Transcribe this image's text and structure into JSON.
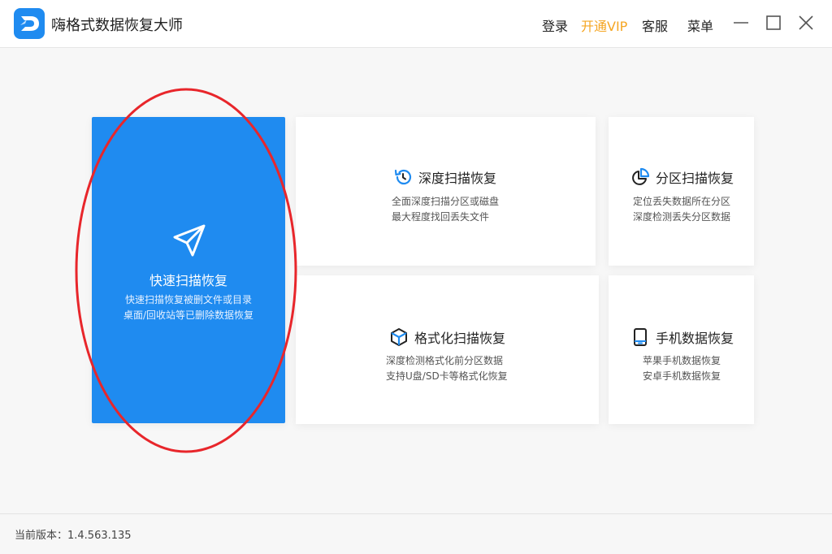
{
  "app": {
    "title": "嗨格式数据恢复大师",
    "logo_icon": "app-logo-d-icon"
  },
  "header": {
    "nav": {
      "login": "登录",
      "vip": "开通VIP",
      "service": "客服",
      "menu": "菜单"
    },
    "window_controls": [
      "minimize-icon",
      "maximize-icon",
      "close-icon"
    ]
  },
  "colors": {
    "accent": "#1f8bf0",
    "vip": "#f5a623",
    "annotation": "#e8262b"
  },
  "cards": {
    "quick": {
      "title": "快速扫描恢复",
      "line1": "快速扫描恢复被删文件或目录",
      "line2": "桌面/回收站等已删除数据恢复",
      "icon": "navigation-arrow-icon"
    },
    "deep": {
      "title": "深度扫描恢复",
      "line1": "全面深度扫描分区或磁盘",
      "line2": "最大程度找回丢失文件",
      "icon": "history-clock-icon"
    },
    "partition": {
      "title": "分区扫描恢复",
      "line1": "定位丢失数据所在分区",
      "line2": "深度检测丢失分区数据",
      "icon": "pie-chart-icon"
    },
    "format": {
      "title": "格式化扫描恢复",
      "line1": "深度检测格式化前分区数据",
      "line2": "支持U盘/SD卡等格式化恢复",
      "icon": "cube-icon"
    },
    "phone": {
      "title": "手机数据恢复",
      "line1": "苹果手机数据恢复",
      "line2": "安卓手机数据恢复",
      "icon": "mobile-phone-icon"
    }
  },
  "footer": {
    "version": "当前版本：1.4.563.135"
  }
}
